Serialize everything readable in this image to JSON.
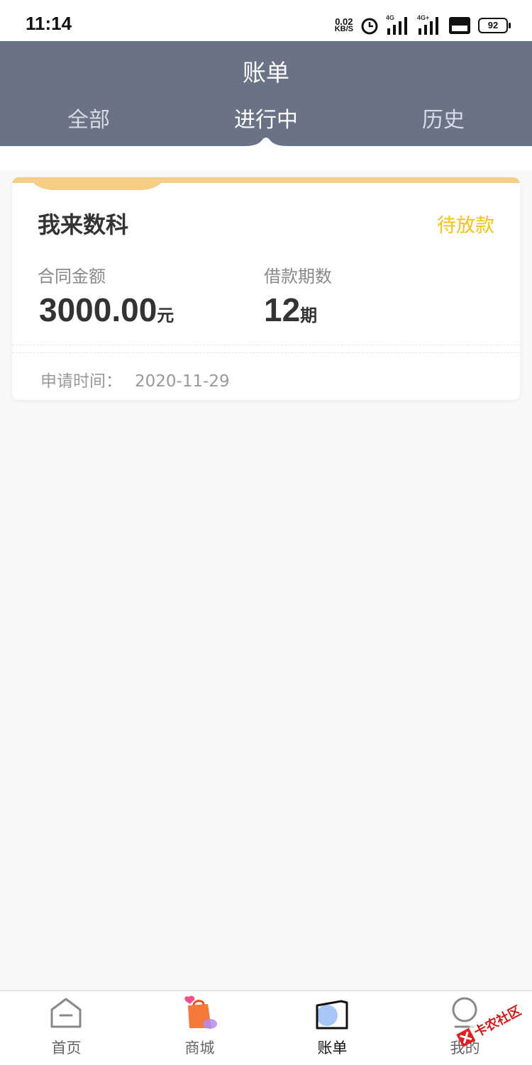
{
  "status_bar": {
    "time": "11:14",
    "net_speed_value": "0.02",
    "net_speed_unit": "KB/S",
    "signal1_label": "4G",
    "signal2_label": "4G+",
    "battery": "92"
  },
  "header": {
    "title": "账单",
    "tabs": [
      {
        "label": "全部",
        "active": false
      },
      {
        "label": "进行中",
        "active": true
      },
      {
        "label": "历史",
        "active": false
      }
    ]
  },
  "loan_card": {
    "name": "我来数科",
    "status": "待放款",
    "amount_label": "合同金额",
    "amount_value": "3000.00",
    "amount_unit": "元",
    "periods_label": "借款期数",
    "periods_value": "12",
    "periods_unit": "期",
    "apply_time_label": "申请时间：",
    "apply_time_value": "2020-11-29"
  },
  "bottom_tabs": [
    {
      "label": "首页",
      "icon": "home-icon"
    },
    {
      "label": "商城",
      "icon": "shopping-bag-icon"
    },
    {
      "label": "账单",
      "icon": "bill-icon",
      "active": true
    },
    {
      "label": "我的",
      "icon": "profile-icon"
    }
  ],
  "colors": {
    "header_bg": "#6a7285",
    "status_accent": "#f5c219",
    "card_top_bar": "#f6cd85"
  }
}
